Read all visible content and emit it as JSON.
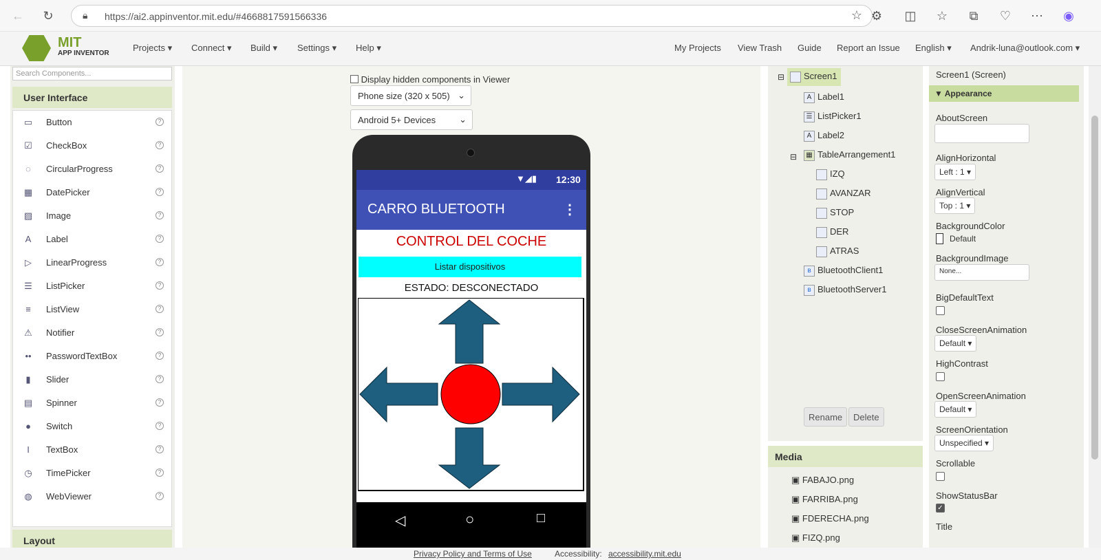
{
  "browser": {
    "url": "https://ai2.appinventor.mit.edu/#4668817591566336"
  },
  "appbar": {
    "logo_top": "MIT",
    "logo_bottom": "APP INVENTOR",
    "menus": [
      "Projects ▾",
      "Connect ▾",
      "Build ▾",
      "Settings ▾",
      "Help ▾"
    ],
    "right_links": [
      "My Projects",
      "View Trash",
      "Guide",
      "Report an Issue",
      "English ▾",
      "Andrik-luna@outlook.com ▾"
    ]
  },
  "palette": {
    "search_placeholder": "Search Components...",
    "section_ui": "User Interface",
    "section_layout": "Layout",
    "items": [
      {
        "label": "Button",
        "icon": "button-icon",
        "glyph": "▭"
      },
      {
        "label": "CheckBox",
        "icon": "checkbox-icon",
        "glyph": "☑"
      },
      {
        "label": "CircularProgress",
        "icon": "circular-progress-icon",
        "glyph": "◌"
      },
      {
        "label": "DatePicker",
        "icon": "calendar-icon",
        "glyph": "▦"
      },
      {
        "label": "Image",
        "icon": "image-icon",
        "glyph": "▨"
      },
      {
        "label": "Label",
        "icon": "label-icon",
        "glyph": "A"
      },
      {
        "label": "LinearProgress",
        "icon": "linear-progress-icon",
        "glyph": "▷"
      },
      {
        "label": "ListPicker",
        "icon": "listpicker-icon",
        "glyph": "☰"
      },
      {
        "label": "ListView",
        "icon": "listview-icon",
        "glyph": "≡"
      },
      {
        "label": "Notifier",
        "icon": "warning-icon",
        "glyph": "⚠"
      },
      {
        "label": "PasswordTextBox",
        "icon": "password-icon",
        "glyph": "••"
      },
      {
        "label": "Slider",
        "icon": "slider-icon",
        "glyph": "▮"
      },
      {
        "label": "Spinner",
        "icon": "spinner-icon",
        "glyph": "▤"
      },
      {
        "label": "Switch",
        "icon": "switch-icon",
        "glyph": "●"
      },
      {
        "label": "TextBox",
        "icon": "textbox-icon",
        "glyph": "I"
      },
      {
        "label": "TimePicker",
        "icon": "clock-icon",
        "glyph": "◷"
      },
      {
        "label": "WebViewer",
        "icon": "globe-icon",
        "glyph": "◍"
      }
    ],
    "help_glyph": "?"
  },
  "viewer": {
    "hidden_label": "Display hidden components in Viewer",
    "phone_size": "Phone size (320 x 505)",
    "device": "Android 5+ Devices",
    "status_time": "12:30",
    "app_title": "CARRO BLUETOOTH",
    "menu_glyph": "⋮",
    "heading": "CONTROL DEL COCHE",
    "list_button": "Listar dispositivos",
    "status": "ESTADO: DESCONECTADO",
    "colors": {
      "arrow": "#1e5f80",
      "stop": "#ff0000",
      "list_bg": "#00ffff",
      "heading": "#cc0000"
    }
  },
  "tree": {
    "nodes": [
      "Screen1",
      "Label1",
      "ListPicker1",
      "Label2",
      "TableArrangement1",
      "IZQ",
      "AVANZAR",
      "STOP",
      "DER",
      "ATRAS",
      "BluetoothClient1",
      "BluetoothServer1"
    ],
    "rename": "Rename",
    "delete": "Delete",
    "collapse_glyph": "⊟"
  },
  "media": {
    "header": "Media",
    "files": [
      "FABAJO.png",
      "FARRIBA.png",
      "FDERECHA.png",
      "FIZQ.png"
    ]
  },
  "properties": {
    "title": "Screen1 (Screen)",
    "group": "▼ Appearance",
    "about": "AboutScreen",
    "align_h": "AlignHorizontal",
    "align_h_val": "Left : 1 ▾",
    "align_v": "AlignVertical",
    "align_v_val": "Top : 1 ▾",
    "bg_color": "BackgroundColor",
    "bg_color_val": "Default",
    "bg_image": "BackgroundImage",
    "bg_image_val": "None...",
    "big_text": "BigDefaultText",
    "close_anim": "CloseScreenAnimation",
    "close_anim_val": "Default ▾",
    "high_contrast": "HighContrast",
    "open_anim": "OpenScreenAnimation",
    "open_anim_val": "Default ▾",
    "orientation": "ScreenOrientation",
    "orientation_val": "Unspecified ▾",
    "scrollable": "Scrollable",
    "status_bar": "ShowStatusBar",
    "title_prop": "Title",
    "help_glyph": "?"
  },
  "footer": {
    "privacy": "Privacy Policy and Terms of Use",
    "access_label": "Accessibility:",
    "access_link": "accessibility.mit.edu"
  }
}
